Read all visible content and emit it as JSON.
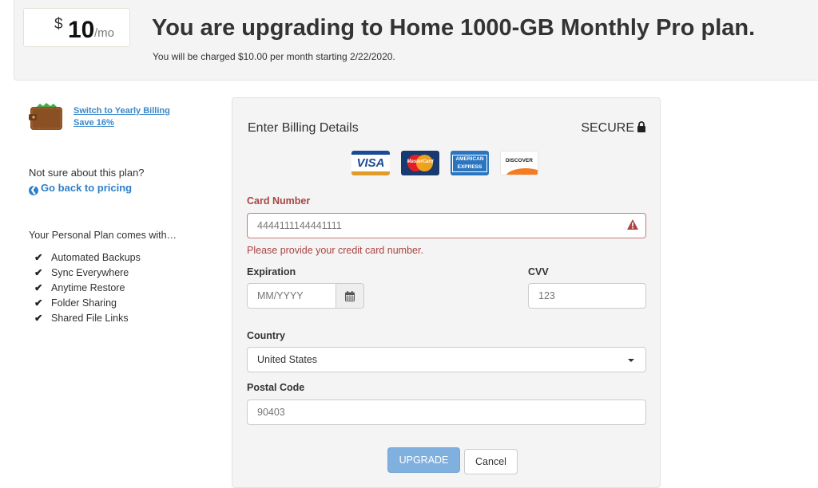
{
  "header": {
    "price": {
      "currency": "$",
      "amount": "10",
      "period": "/mo"
    },
    "title": "You are upgrading to Home 1000-GB Monthly Pro plan.",
    "subtitle": "You will be charged $10.00 per month starting 2/22/2020."
  },
  "sidebar": {
    "wallet_icon": "wallet-icon",
    "yearly_link_line1": "Switch to Yearly Billing",
    "yearly_link_line2": "Save 16%",
    "not_sure": "Not sure about this plan?",
    "back_link": "Go back to pricing",
    "back_icon": "❮",
    "plan_heading": "Your Personal Plan comes with…",
    "check_glyph": "✔",
    "features": [
      "Automated Backups",
      "Sync Everywhere",
      "Anytime Restore",
      "Folder Sharing",
      "Shared File Links"
    ]
  },
  "billing": {
    "title": "Enter Billing Details",
    "secure": "SECURE",
    "cards": {
      "visa": "VISA",
      "mastercard": "MasterCard",
      "amex_line1": "AMERICAN",
      "amex_line2": "EXPRESS",
      "discover": "DISCOVER"
    },
    "card_number": {
      "label": "Card Number",
      "value": "4444111144441111",
      "error": "Please provide your credit card number."
    },
    "expiration": {
      "label": "Expiration",
      "placeholder": "MM/YYYY"
    },
    "cvv": {
      "label": "CVV",
      "placeholder": "123"
    },
    "country": {
      "label": "Country",
      "value": "United States"
    },
    "postal": {
      "label": "Postal Code",
      "placeholder": "90403"
    },
    "upgrade_button": "UPGRADE",
    "cancel_button": "Cancel"
  },
  "colors": {
    "link": "#3a87c8",
    "error": "#a94442",
    "upgrade_button": "#7fb0de",
    "panel_bg": "#f4f4f4"
  }
}
